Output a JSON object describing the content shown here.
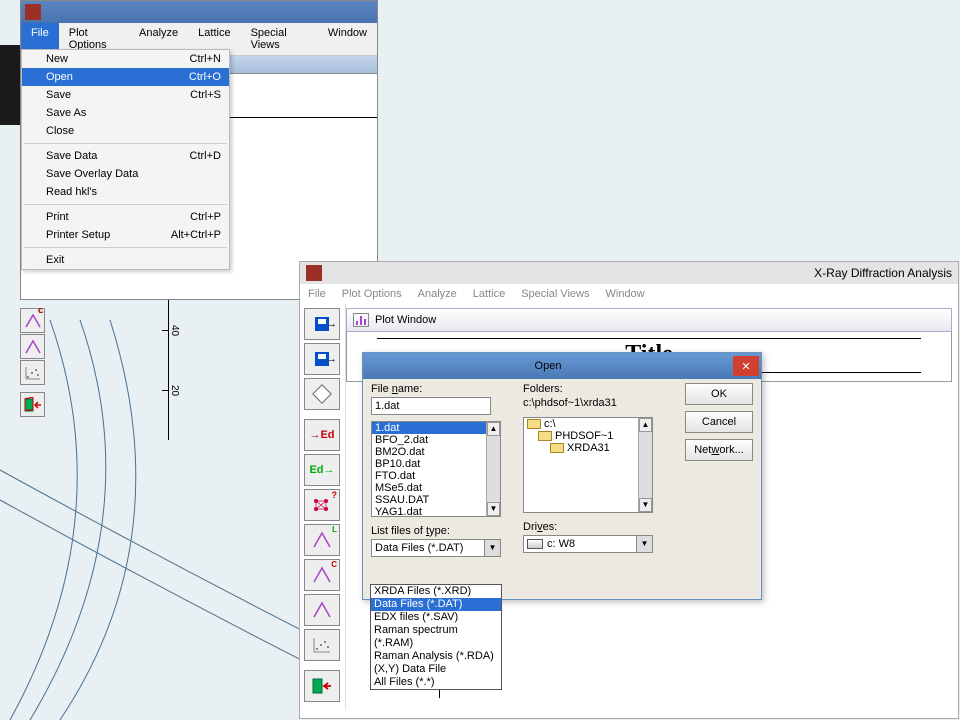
{
  "win1": {
    "menus": [
      "File",
      "Plot Options",
      "Analyze",
      "Lattice",
      "Special Views",
      "Window"
    ],
    "active_menu": "File",
    "file_menu": [
      {
        "label": "New",
        "shortcut": "Ctrl+N"
      },
      {
        "label": "Open",
        "shortcut": "Ctrl+O",
        "hl": true
      },
      {
        "label": "Save",
        "shortcut": "Ctrl+S"
      },
      {
        "label": "Save As",
        "shortcut": ""
      },
      {
        "label": "Close",
        "shortcut": ""
      },
      {
        "sep": true
      },
      {
        "label": "Save Data",
        "shortcut": "Ctrl+D"
      },
      {
        "label": "Save Overlay Data",
        "shortcut": ""
      },
      {
        "label": "Read hkl's",
        "shortcut": ""
      },
      {
        "sep": true
      },
      {
        "label": "Print",
        "shortcut": "Ctrl+P"
      },
      {
        "label": "Printer Setup",
        "shortcut": "Alt+Ctrl+P"
      },
      {
        "sep": true
      },
      {
        "label": "Exit",
        "shortcut": ""
      }
    ]
  },
  "axis_ticks": [
    "40",
    "20"
  ],
  "win2": {
    "title": "X-Ray Diffraction Analysis",
    "menus": [
      "File",
      "Plot Options",
      "Analyze",
      "Lattice",
      "Special Views",
      "Window"
    ],
    "plot_window_label": "Plot Window",
    "plot_title": "Title"
  },
  "open_dlg": {
    "title": "Open",
    "file_name_label": "File name:",
    "file_name_value": "1.dat",
    "folders_label": "Folders:",
    "folders_path": "c:\\phdsof~1\\xrda31",
    "files": [
      "1.dat",
      "BFO_2.dat",
      "BM2O.dat",
      "BP10.dat",
      "FTO.dat",
      "MSe5.dat",
      "SSAU.DAT",
      "YAG1.dat"
    ],
    "folders": [
      "c:\\",
      "PHDSOF~1",
      "XRDA31"
    ],
    "list_type_label": "List files of type:",
    "list_type_value": "Data Files (*.DAT)",
    "drives_label": "Drives:",
    "drives_value": "c: W8",
    "btn_ok": "OK",
    "btn_cancel": "Cancel",
    "btn_network": "Network..."
  },
  "type_options": [
    "XRDA Files (*.XRD)",
    "Data Files (*.DAT)",
    "EDX files (*.SAV)",
    "Raman spectrum (*.RAM)",
    "Raman Analysis (*.RDA)",
    "(X,Y) Data File",
    "All Files (*.*)"
  ],
  "toolbar1_icons": [
    "peak-l-icon",
    "peak-c-icon",
    "scatter-icon",
    "",
    "exit-icon"
  ],
  "toolbar2_icons": [
    "save-arrow-icon",
    "save-arrow-icon",
    "diamond-icon",
    "ed-red-icon",
    "ed-green-icon",
    "lattice-icon",
    "peak-l-icon",
    "peak-c-icon",
    "peak-x-icon",
    "scatter-icon",
    "exit-icon"
  ]
}
